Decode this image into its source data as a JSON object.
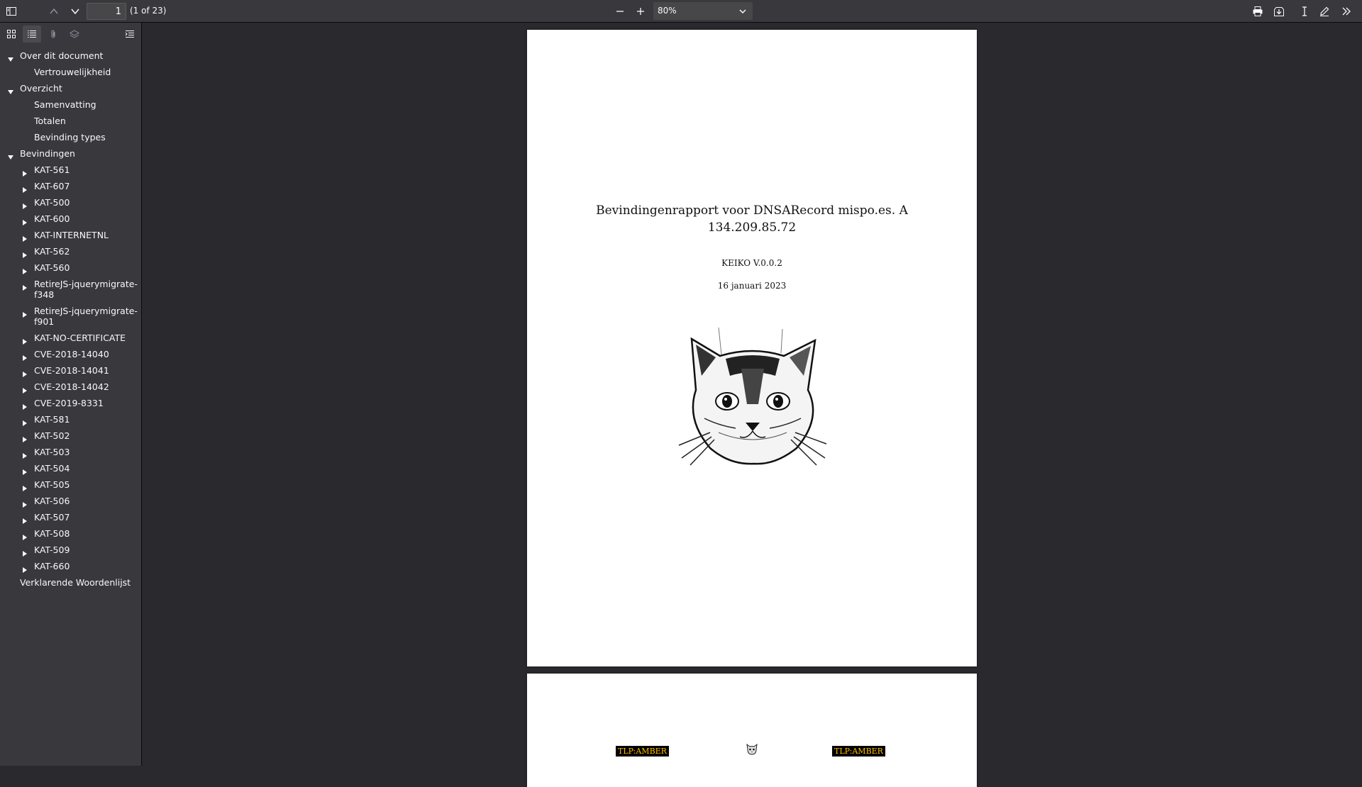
{
  "toolbar": {
    "page_number": "1",
    "page_count": "(1 of 23)",
    "zoom": "80%",
    "icons": [
      "sidebar-toggle-icon",
      "previous-page-icon",
      "next-page-icon",
      "zoom-out-icon",
      "zoom-in-icon",
      "print-icon",
      "download-icon",
      "text-select-icon",
      "edit-icon",
      "more-tools-icon"
    ]
  },
  "sidebar": {
    "tabs": [
      "thumbnails-icon",
      "outline-icon",
      "attachments-icon",
      "layers-icon",
      "current-outline-item-icon"
    ],
    "outline": [
      {
        "label": "Over dit document",
        "level": 0,
        "toggle": "expanded"
      },
      {
        "label": "Vertrouwelijkheid",
        "level": 1,
        "toggle": "none"
      },
      {
        "label": "Overzicht",
        "level": 0,
        "toggle": "expanded"
      },
      {
        "label": "Samenvatting",
        "level": 1,
        "toggle": "none"
      },
      {
        "label": "Totalen",
        "level": 1,
        "toggle": "none"
      },
      {
        "label": "Bevinding types",
        "level": 1,
        "toggle": "none"
      },
      {
        "label": "Bevindingen",
        "level": 0,
        "toggle": "expanded"
      },
      {
        "label": "KAT-561",
        "level": 1,
        "toggle": "collapsed"
      },
      {
        "label": "KAT-607",
        "level": 1,
        "toggle": "collapsed"
      },
      {
        "label": "KAT-500",
        "level": 1,
        "toggle": "collapsed"
      },
      {
        "label": "KAT-600",
        "level": 1,
        "toggle": "collapsed"
      },
      {
        "label": "KAT-INTERNETNL",
        "level": 1,
        "toggle": "collapsed"
      },
      {
        "label": "KAT-562",
        "level": 1,
        "toggle": "collapsed"
      },
      {
        "label": "KAT-560",
        "level": 1,
        "toggle": "collapsed"
      },
      {
        "label": "RetireJS-jquerymigrate-f348",
        "level": 1,
        "toggle": "collapsed",
        "wrap": true
      },
      {
        "label": "RetireJS-jquerymigrate-f901",
        "level": 1,
        "toggle": "collapsed",
        "wrap": true
      },
      {
        "label": "KAT-NO-CERTIFICATE",
        "level": 1,
        "toggle": "collapsed"
      },
      {
        "label": "CVE-2018-14040",
        "level": 1,
        "toggle": "collapsed"
      },
      {
        "label": "CVE-2018-14041",
        "level": 1,
        "toggle": "collapsed"
      },
      {
        "label": "CVE-2018-14042",
        "level": 1,
        "toggle": "collapsed"
      },
      {
        "label": "CVE-2019-8331",
        "level": 1,
        "toggle": "collapsed"
      },
      {
        "label": "KAT-581",
        "level": 1,
        "toggle": "collapsed"
      },
      {
        "label": "KAT-502",
        "level": 1,
        "toggle": "collapsed"
      },
      {
        "label": "KAT-503",
        "level": 1,
        "toggle": "collapsed"
      },
      {
        "label": "KAT-504",
        "level": 1,
        "toggle": "collapsed"
      },
      {
        "label": "KAT-505",
        "level": 1,
        "toggle": "collapsed"
      },
      {
        "label": "KAT-506",
        "level": 1,
        "toggle": "collapsed"
      },
      {
        "label": "KAT-507",
        "level": 1,
        "toggle": "collapsed"
      },
      {
        "label": "KAT-508",
        "level": 1,
        "toggle": "collapsed"
      },
      {
        "label": "KAT-509",
        "level": 1,
        "toggle": "collapsed"
      },
      {
        "label": "KAT-660",
        "level": 1,
        "toggle": "collapsed"
      },
      {
        "label": "Verklarende Woordenlijst",
        "level": 0,
        "toggle": "none"
      }
    ]
  },
  "document": {
    "page1": {
      "title_line1": "Bevindingenrapport voor DNSARecord mispo.es. A",
      "title_line2": "134.209.85.72",
      "version": "KEIKO V.0.0.2",
      "date": "16 januari 2023",
      "image": "cat-head-illustration"
    },
    "page2": {
      "tlp_left": "TLP:AMBER",
      "tlp_right": "TLP:AMBER",
      "image": "small-cat-logo"
    }
  },
  "colors": {
    "toolbar_bg": "#38383d",
    "viewer_bg": "#2a2a2e",
    "tlp_bg": "#000000",
    "tlp_text": "#ffc000"
  }
}
